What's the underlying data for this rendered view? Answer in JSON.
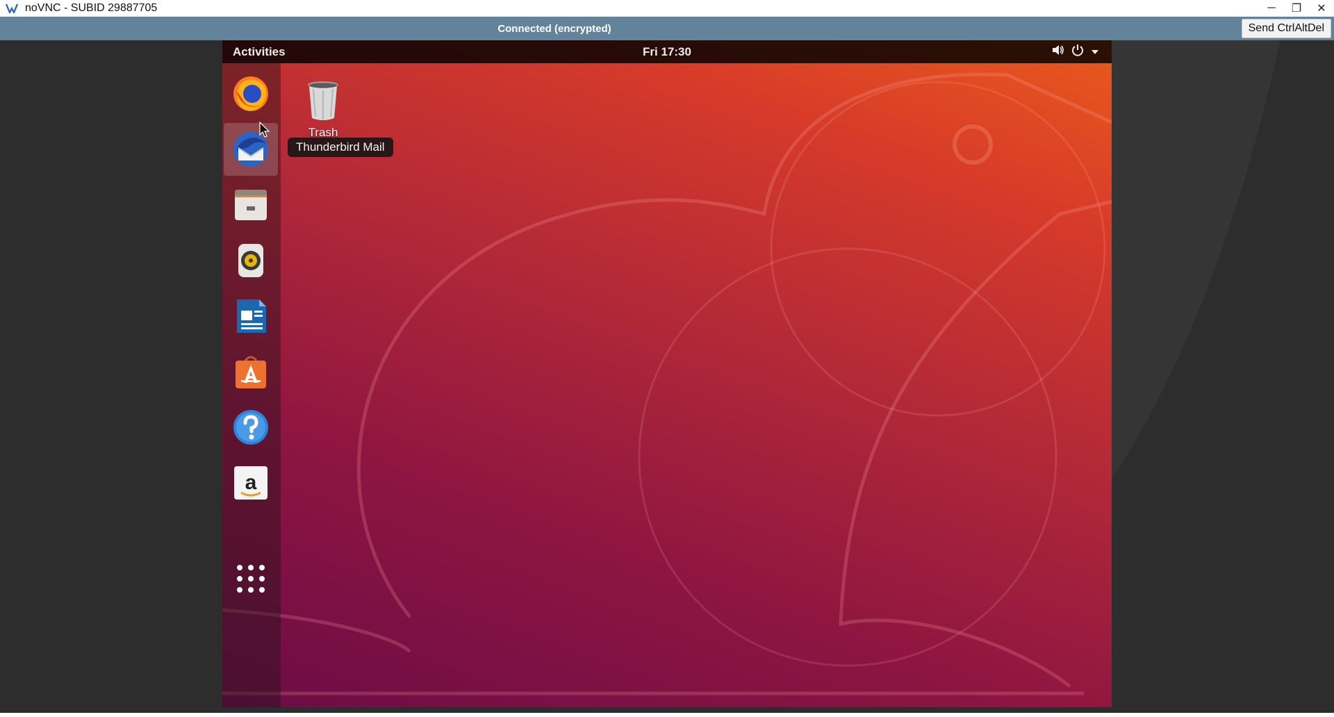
{
  "window": {
    "title": "noVNC - SUBID 29887705",
    "controls": {
      "minimize": "─",
      "restore": "❐",
      "close": "✕"
    }
  },
  "vnc": {
    "status": "Connected (encrypted)",
    "ctrl_alt_del_label": "Send CtrlAltDel"
  },
  "desktop": {
    "panel": {
      "activities": "Activities",
      "clock": "Fri 17:30"
    },
    "icons": [
      {
        "label": "Trash",
        "icon": "trash-icon"
      }
    ],
    "tooltip": "Thunderbird Mail",
    "dock": [
      {
        "name": "Firefox",
        "icon": "firefox-icon"
      },
      {
        "name": "Thunderbird Mail",
        "icon": "thunderbird-icon",
        "active": true
      },
      {
        "name": "Files",
        "icon": "files-icon"
      },
      {
        "name": "Rhythmbox",
        "icon": "rhythmbox-icon"
      },
      {
        "name": "LibreOffice Writer",
        "icon": "writer-icon"
      },
      {
        "name": "Ubuntu Software",
        "icon": "software-icon"
      },
      {
        "name": "Help",
        "icon": "help-icon"
      },
      {
        "name": "Amazon",
        "icon": "amazon-icon"
      },
      {
        "name": "Show Applications",
        "icon": "app-grid-icon"
      }
    ],
    "colors": {
      "wallpaper_top": "#ea5a1c",
      "wallpaper_bottom": "#6b0c46",
      "vnc_bar": "#62839a"
    }
  }
}
